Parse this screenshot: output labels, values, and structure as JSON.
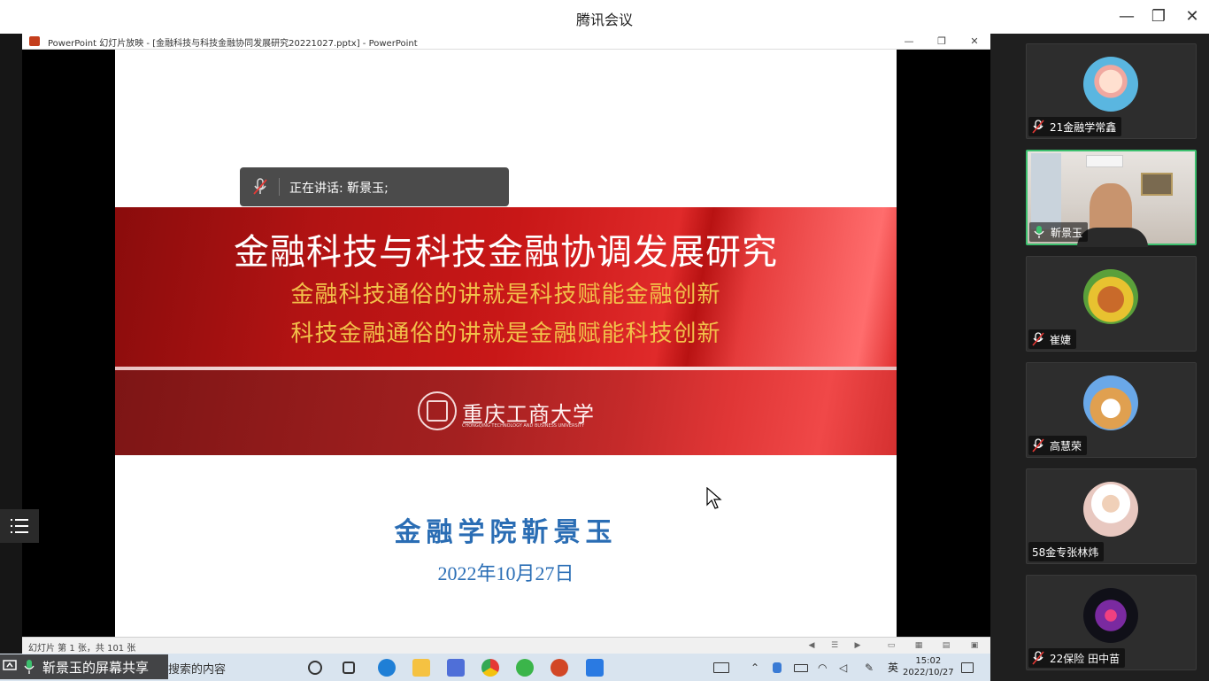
{
  "meeting": {
    "title": "腾讯会议"
  },
  "ppt": {
    "window_title": "PowerPoint 幻灯片放映 - [金融科技与科技金融协同发展研究20221027.pptx] - PowerPoint",
    "status": "幻灯片 第 1 张，共 101 张"
  },
  "slide": {
    "title": "金融科技与科技金融协调发展研究",
    "subtitle1": "金融科技通俗的讲就是科技赋能金融创新",
    "subtitle2": "科技金融通俗的讲就是金融赋能科技创新",
    "university": "重庆工商大学",
    "university_en": "CHONGQING TECHNOLOGY AND BUSINESS UNIVERSITY",
    "author": "金融学院靳景玉",
    "date": "2022年10月27日"
  },
  "speaking": {
    "text": "正在讲话: 靳景玉;"
  },
  "share": {
    "sharer": "靳景玉的屏幕共享",
    "search_placeholder": "搜索的内容"
  },
  "taskbar": {
    "ime": "英",
    "time": "15:02",
    "date": "2022/10/27"
  },
  "participants": [
    {
      "name": "21金融学常鑫",
      "muted": true
    },
    {
      "name": "靳景玉",
      "muted": false,
      "speaking": true
    },
    {
      "name": "崔婕",
      "muted": true
    },
    {
      "name": "高慧荣",
      "muted": true
    },
    {
      "name": "58金专张林炜",
      "muted": false
    },
    {
      "name": "22保险 田中苗",
      "muted": true
    }
  ],
  "colors": {
    "active_border": "#3cc06e",
    "banner_red": "#c81717",
    "subtitle_gold": "#f2c04a",
    "author_blue": "#2a6db4"
  }
}
